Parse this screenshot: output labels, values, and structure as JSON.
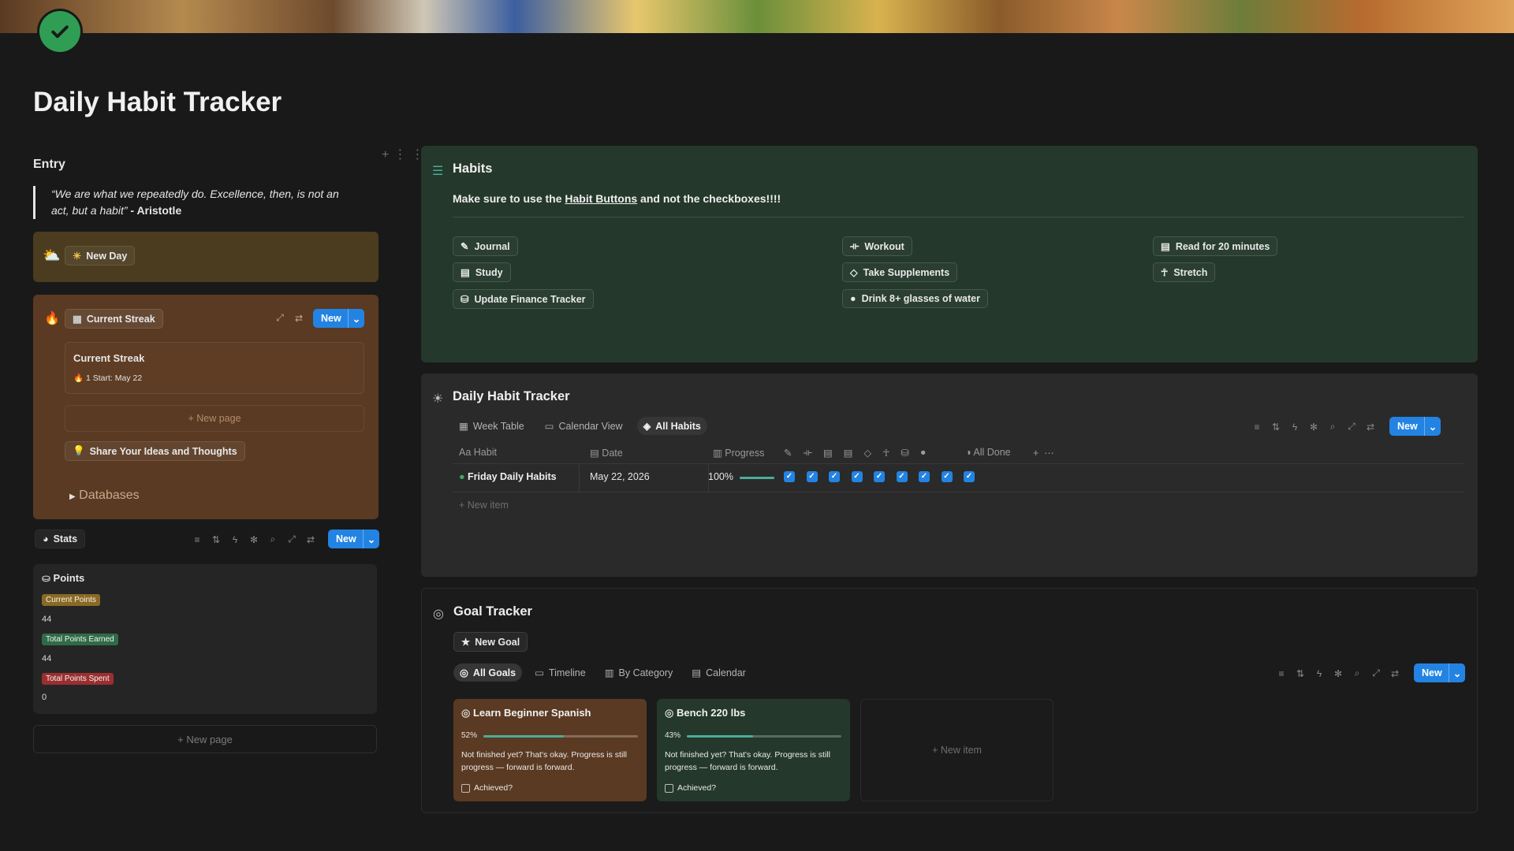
{
  "page": {
    "title": "Daily Habit Tracker",
    "icon": "check-circle-icon"
  },
  "entry": {
    "heading": "Entry",
    "quote_text": "“We are what we repeatedly do. Excellence, then, is not an act, but a habit”",
    "quote_author": "- Aristotle",
    "new_day_label": "New Day",
    "streak": {
      "view_label": "Current Streak",
      "new_label": "New",
      "card_title": "Current Streak",
      "card_subtitle": "🔥 1 Start: May 22",
      "new_page_label": "+ New page",
      "share_label": "Share Your Ideas and Thoughts",
      "databases_label": "Databases"
    },
    "stats": {
      "view_label": "Stats",
      "new_label": "New",
      "card_title": "Points",
      "items": [
        {
          "label": "Current Points",
          "value": "44",
          "color": "#8a6a23"
        },
        {
          "label": "Total Points Earned",
          "value": "44",
          "color": "#2f6b47"
        },
        {
          "label": "Total Points Spent",
          "value": "0",
          "color": "#9b2f2f"
        }
      ]
    },
    "new_page_label": "+ New page"
  },
  "habits": {
    "title": "Habits",
    "note_before": "Make sure to use the ",
    "note_link": "Habit Buttons",
    "note_after": " and not the checkboxes!!!!",
    "buttons": [
      {
        "label": "Journal",
        "icon": "pencil-icon"
      },
      {
        "label": "Study",
        "icon": "book-icon"
      },
      {
        "label": "Update Finance Tracker",
        "icon": "money-icon"
      },
      {
        "label": "Workout",
        "icon": "dumbbell-icon"
      },
      {
        "label": "Take Supplements",
        "icon": "pill-icon"
      },
      {
        "label": "Drink 8+ glasses of water",
        "icon": "drop-icon"
      },
      {
        "label": "Read for 20 minutes",
        "icon": "book-icon"
      },
      {
        "label": "Stretch",
        "icon": "person-icon"
      }
    ]
  },
  "tracker": {
    "title": "Daily Habit Tracker",
    "tabs": [
      "Week Table",
      "Calendar View",
      "All Habits"
    ],
    "new_label": "New",
    "columns": {
      "habit": "Habit",
      "date": "Date",
      "progress": "Progress",
      "all_done": "All Done"
    },
    "rows": [
      {
        "habit": "Friday Daily Habits",
        "date": "May 22, 2026",
        "progress_text": "100%",
        "progress": 1.0,
        "checks": 9
      }
    ],
    "new_item_label": "+ New item"
  },
  "goals": {
    "title": "Goal Tracker",
    "new_goal_label": "New Goal",
    "tabs": [
      "All Goals",
      "Timeline",
      "By Category",
      "Calendar"
    ],
    "new_label": "New",
    "cards": [
      {
        "title": "Learn Beginner Spanish",
        "progress_text": "52%",
        "progress": 0.52,
        "text": "Not finished yet? That's okay. Progress is still progress — forward is forward.",
        "achieved_label": "Achieved?",
        "color": "#5a3a22"
      },
      {
        "title": "Bench 220 lbs",
        "progress_text": "43%",
        "progress": 0.43,
        "text": "Not finished yet? That's okay. Progress is still progress — forward is forward.",
        "achieved_label": "Achieved?",
        "color": "#24382b"
      }
    ],
    "new_item_label": "+ New item"
  }
}
